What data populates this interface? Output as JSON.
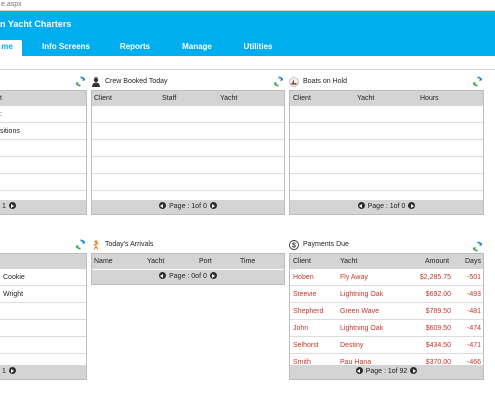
{
  "browser": {
    "url_fragment": "e.aspx"
  },
  "app": {
    "title": "n Yacht Charters"
  },
  "nav": {
    "tabs": [
      "me",
      "Info Screens",
      "Reports",
      "Manage",
      "Utilities"
    ]
  },
  "panels": {
    "left_top": {
      "header": [
        "t"
      ],
      "rows": [
        [
          ":"
        ],
        [
          "sitions"
        ],
        [
          ""
        ],
        [
          ""
        ],
        [
          ""
        ]
      ],
      "pager": "1"
    },
    "crew": {
      "title": "Crew Booked Today",
      "header": [
        "Client",
        "Staff",
        "Yacht"
      ],
      "pager": "Page : 1of 0"
    },
    "hold": {
      "title": "Boats on Hold",
      "header": [
        "Client",
        "Yacht",
        "Hours"
      ],
      "pager": "Page : 1of 0"
    },
    "left_bottom": {
      "rows": [
        [
          "Cookie"
        ],
        [
          "Wright"
        ],
        [
          ""
        ],
        [
          ""
        ],
        [
          ""
        ],
        [
          ""
        ]
      ],
      "pager": "1"
    },
    "arrivals": {
      "title": "Today's Arrivals",
      "header": [
        "Name",
        "Yacht",
        "Port",
        "Time"
      ],
      "pager": "Page : 0of 0"
    },
    "payments": {
      "title": "Payments Due",
      "header": [
        "Client",
        "Yacht",
        "Amount",
        "Days"
      ],
      "rows": [
        {
          "client": "Hoben",
          "yacht": "Fly Away",
          "amount": "$2,285.75",
          "days": "-501"
        },
        {
          "client": "Steevie",
          "yacht": "Lightning Oak",
          "amount": "$692.00",
          "days": "-493"
        },
        {
          "client": "Shepherd",
          "yacht": "Green Wave",
          "amount": "$789.50",
          "days": "-481"
        },
        {
          "client": "John",
          "yacht": "Lightning Oak",
          "amount": "$609.50",
          "days": "-474"
        },
        {
          "client": "Selhorst",
          "yacht": "Destiny",
          "amount": "$434.50",
          "days": "-471"
        },
        {
          "client": "Smith",
          "yacht": "Pau Hana",
          "amount": "$370.00",
          "days": "-466"
        }
      ],
      "pager": "Page : 1of 92"
    }
  },
  "colors": {
    "accent": "#00aeef",
    "due_text": "#c0392b",
    "grid_header": "#d4d4d4"
  }
}
